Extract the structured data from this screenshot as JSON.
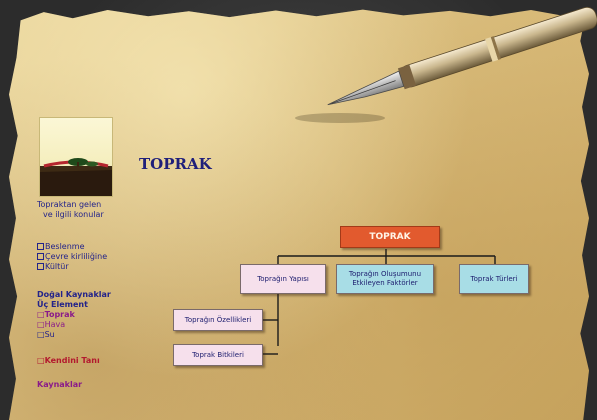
{
  "page": {
    "title": "TOPRAK"
  },
  "sidebar": {
    "intro_link": "Topraktan gelen",
    "intro_link2": "ve ilgili konular",
    "items": [
      "Beslenme",
      "Çevre kirliliğine",
      "Kültür"
    ],
    "section_title": "Doğal Kaynaklar",
    "section_sub": "Üç Element",
    "section_items": [
      "Toprak",
      "Hava",
      "Su"
    ],
    "extra_link": "Kendini Tanı",
    "bottom_link": "Kaynaklar"
  },
  "diagram": {
    "root": "TOPRAK",
    "level1": [
      "Toprağın Yapısı",
      "Toprağın Oluşumunu Etkileyen Faktörler",
      "Toprak Türleri"
    ],
    "level2": [
      "Toprağın Özellikleri",
      "Toprak Bitkileri"
    ]
  },
  "colors": {
    "root": "#e25a2e",
    "pink_node": "#f6e0ec",
    "blue_node": "#a8dde6",
    "link": "#23238a",
    "link_red": "#b3192e",
    "title": "#1f1f7a"
  }
}
